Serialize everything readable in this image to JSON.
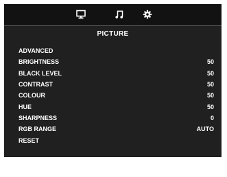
{
  "tabs": [
    {
      "icon": "monitor-icon",
      "active": true
    },
    {
      "icon": "music-note-icon",
      "active": false
    },
    {
      "icon": "gear-icon",
      "active": false
    }
  ],
  "menu": {
    "title": "PICTURE",
    "items": [
      {
        "label": "ADVANCED",
        "value": ""
      },
      {
        "label": "BRIGHTNESS",
        "value": "50"
      },
      {
        "label": "BLACK LEVEL",
        "value": "50"
      },
      {
        "label": "CONTRAST",
        "value": "50"
      },
      {
        "label": "COLOUR",
        "value": "50"
      },
      {
        "label": "HUE",
        "value": "50"
      },
      {
        "label": "SHARPNESS",
        "value": "0"
      },
      {
        "label": "RGB RANGE",
        "value": "AUTO"
      },
      {
        "label": "RESET",
        "value": ""
      }
    ]
  },
  "colors": {
    "panel": "#202020",
    "tab_bar": "#121212",
    "text": "#ffffff"
  }
}
